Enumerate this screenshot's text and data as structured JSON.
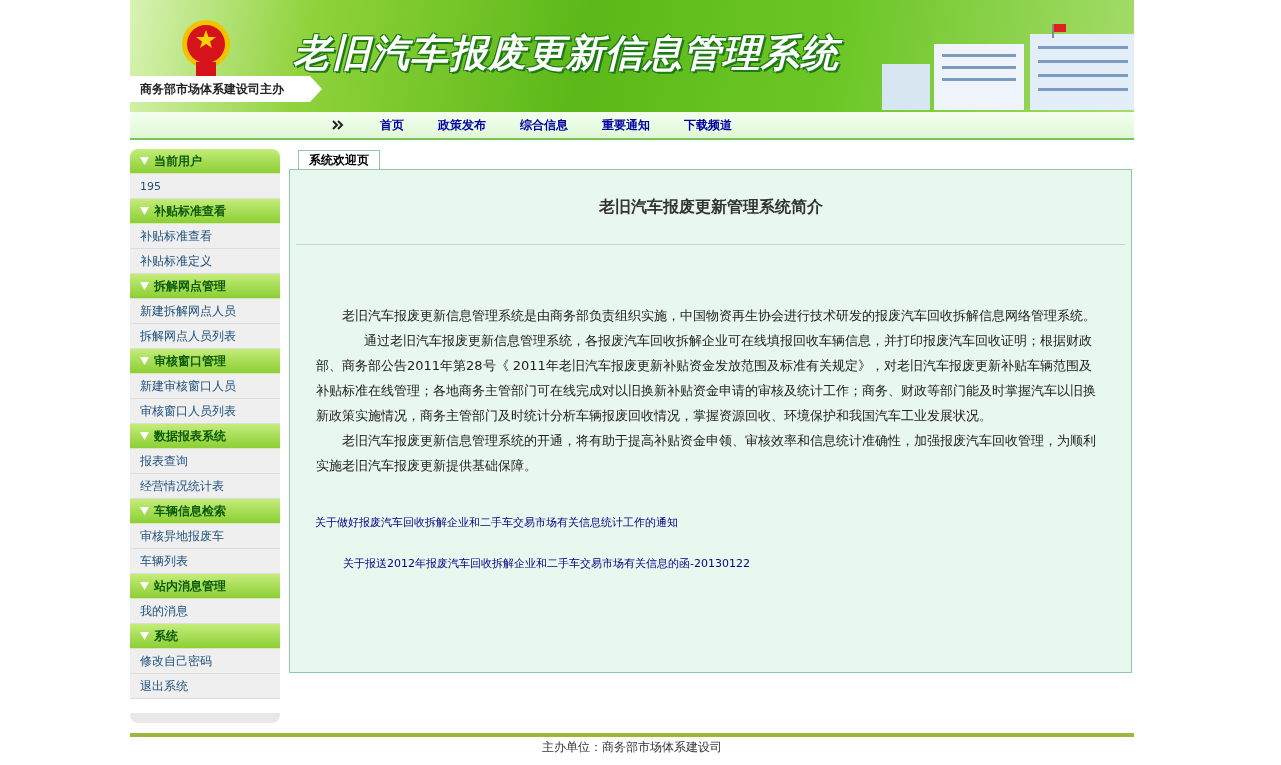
{
  "header": {
    "title": "老旧汽车报废更新信息管理系统",
    "sponsor": "商务部市场体系建设司主办"
  },
  "nav": [
    {
      "label": "首页"
    },
    {
      "label": "政策发布"
    },
    {
      "label": "综合信息"
    },
    {
      "label": "重要通知"
    },
    {
      "label": "下载频道"
    }
  ],
  "sidebar": {
    "sections": [
      {
        "title": "当前用户",
        "items": [
          {
            "label": "195",
            "kind": "text"
          }
        ]
      },
      {
        "title": "补贴标准查看",
        "items": [
          {
            "label": "补贴标准查看",
            "kind": "link"
          },
          {
            "label": "补贴标准定义",
            "kind": "link"
          }
        ]
      },
      {
        "title": "拆解网点管理",
        "items": [
          {
            "label": "新建拆解网点人员",
            "kind": "link"
          },
          {
            "label": "拆解网点人员列表",
            "kind": "link"
          }
        ]
      },
      {
        "title": "审核窗口管理",
        "items": [
          {
            "label": "新建审核窗口人员",
            "kind": "link"
          },
          {
            "label": "审核窗口人员列表",
            "kind": "link"
          }
        ]
      },
      {
        "title": "数据报表系统",
        "items": [
          {
            "label": "报表查询",
            "kind": "link"
          },
          {
            "label": "经营情况统计表",
            "kind": "link"
          }
        ]
      },
      {
        "title": "车辆信息检索",
        "items": [
          {
            "label": "审核异地报废车",
            "kind": "link"
          },
          {
            "label": "车辆列表",
            "kind": "link"
          }
        ]
      },
      {
        "title": "站内消息管理",
        "items": [
          {
            "label": "我的消息",
            "kind": "link"
          }
        ]
      },
      {
        "title": "系统",
        "items": [
          {
            "label": "修改自己密码",
            "kind": "link"
          },
          {
            "label": "退出系统",
            "kind": "link"
          }
        ]
      }
    ]
  },
  "tabs": [
    {
      "label": "系统欢迎页",
      "selected": true
    }
  ],
  "article": {
    "title": "老旧汽车报废更新管理系统简介",
    "paragraphs": [
      "老旧汽车报废更新信息管理系统是由商务部负责组织实施，中国物资再生协会进行技术研发的报废汽车回收拆解信息网络管理系统。",
      "通过老旧汽车报废更新信息管理系统，各报废汽车回收拆解企业可在线填报回收车辆信息，并打印报废汽车回收证明；根据财政部、商务部公告2011年第28号《 2011年老旧汽车报废更新补贴资金发放范围及标准有关规定》，对老旧汽车报废更新补贴车辆范围及补贴标准在线管理；各地商务主管部门可在线完成对以旧换新补贴资金申请的审核及统计工作；商务、财政等部门能及时掌握汽车以旧换新政策实施情况，商务主管部门及时统计分析车辆报废回收情况，掌握资源回收、环境保护和我国汽车工业发展状况。",
      "老旧汽车报废更新信息管理系统的开通，将有助于提高补贴资金申领、审核效率和信息统计准确性，加强报废汽车回收管理，为顺利实施老旧汽车报废更新提供基础保障。"
    ],
    "links": [
      "关于做好报废汽车回收拆解企业和二手车交易市场有关信息统计工作的通知",
      "关于报送2012年报废汽车回收拆解企业和二手车交易市场有关信息的函-20130122"
    ]
  },
  "footer": {
    "text": "主办单位：商务部市场体系建设司"
  }
}
